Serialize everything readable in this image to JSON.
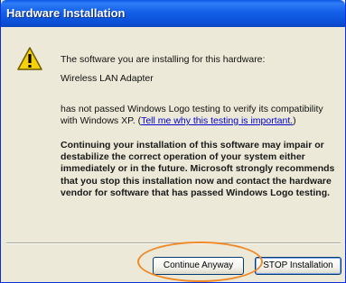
{
  "window": {
    "title": "Hardware Installation"
  },
  "message": {
    "line1": "The software you are installing for this hardware:",
    "device": "Wireless LAN Adapter",
    "compat_before": "has not passed Windows Logo testing to verify its compatibility with Windows XP. (",
    "compat_link": "Tell me why this testing is important.",
    "compat_after": ")",
    "warning": "Continuing your installation of this software may impair or destabilize the correct operation of your system either immediately or in the future. Microsoft strongly recommends that you stop this installation now and contact the hardware vendor for software that has passed Windows Logo testing."
  },
  "buttons": {
    "continue_label": "Continue Anyway",
    "stop_label": "STOP Installation"
  },
  "colors": {
    "titlebar": "#0a58e6",
    "highlight": "#ee8a2a",
    "dialog_bg": "#ece9d8"
  },
  "icons": {
    "warning": "warning-icon"
  }
}
